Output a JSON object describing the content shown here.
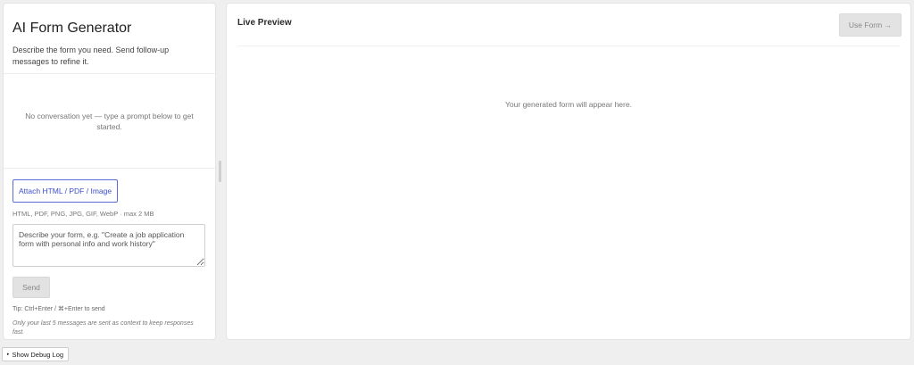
{
  "left": {
    "title": "AI Form Generator",
    "description": "Describe the form you need. Send follow-up messages to refine it.",
    "empty_conversation": "No conversation yet — type a prompt below to get started.",
    "attach_label": "Attach HTML / PDF / Image",
    "file_hint": "HTML, PDF, PNG, JPG, GIF, WebP · max 2 MB",
    "prompt_placeholder": "Describe your form, e.g. \"Create a job application form with personal info and work history\"",
    "prompt_value": "",
    "send_label": "Send",
    "tip": "Tip: Ctrl+Enter / ⌘+Enter to send",
    "context_note": "Only your last 5 messages are sent as context to keep responses fast."
  },
  "preview": {
    "title": "Live Preview",
    "use_form_label": "Use Form →",
    "empty_text": "Your generated form will appear here."
  },
  "debug": {
    "caret": "▸",
    "label": "Show Debug Log"
  },
  "colors": {
    "accent": "#3b4fd0",
    "background": "#efefef",
    "panel": "#ffffff",
    "disabled_button": "#e3e3e3"
  }
}
